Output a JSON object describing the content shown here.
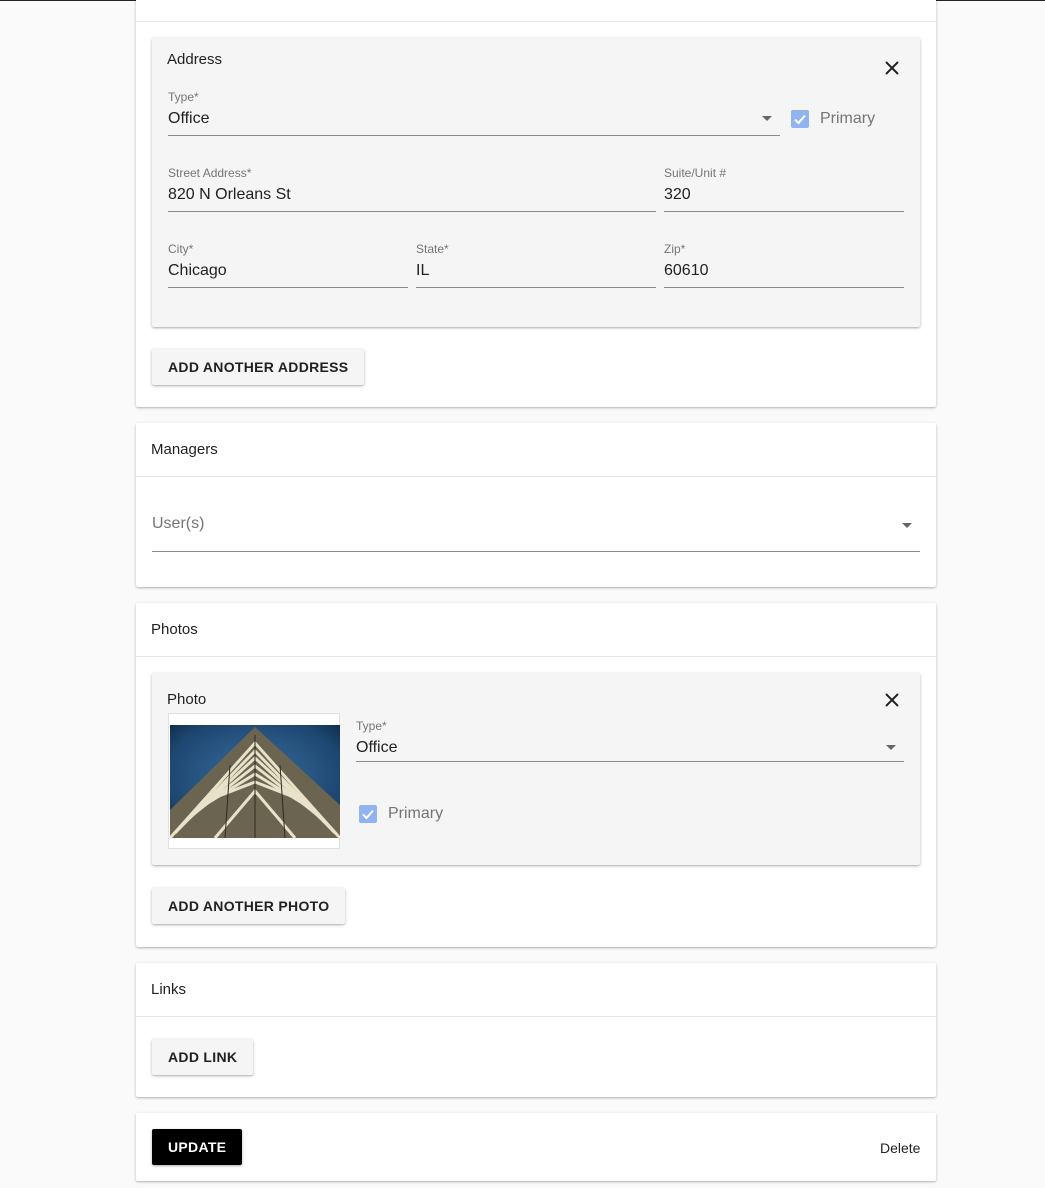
{
  "address_section": {
    "sub_title": "Address",
    "type_label": "Type*",
    "type_value": "Office",
    "primary_label": "Primary",
    "street_label": "Street Address*",
    "street_value": "820 N Orleans St",
    "suite_label": "Suite/Unit #",
    "suite_value": "320",
    "city_label": "City*",
    "city_value": "Chicago",
    "state_label": "State*",
    "state_value": "IL",
    "zip_label": "Zip*",
    "zip_value": "60610",
    "add_button": "ADD ANOTHER ADDRESS"
  },
  "managers_section": {
    "title": "Managers",
    "users_placeholder": "User(s)"
  },
  "photos_section": {
    "title": "Photos",
    "sub_title": "Photo",
    "type_label": "Type*",
    "type_value": "Office",
    "primary_label": "Primary",
    "add_button": "ADD ANOTHER PHOTO"
  },
  "links_section": {
    "title": "Links",
    "add_button": "ADD LINK"
  },
  "actions": {
    "update": "UPDATE",
    "delete": "Delete"
  },
  "colors": {
    "checkbox": "#90b4f0",
    "primary_button": "#000000"
  }
}
